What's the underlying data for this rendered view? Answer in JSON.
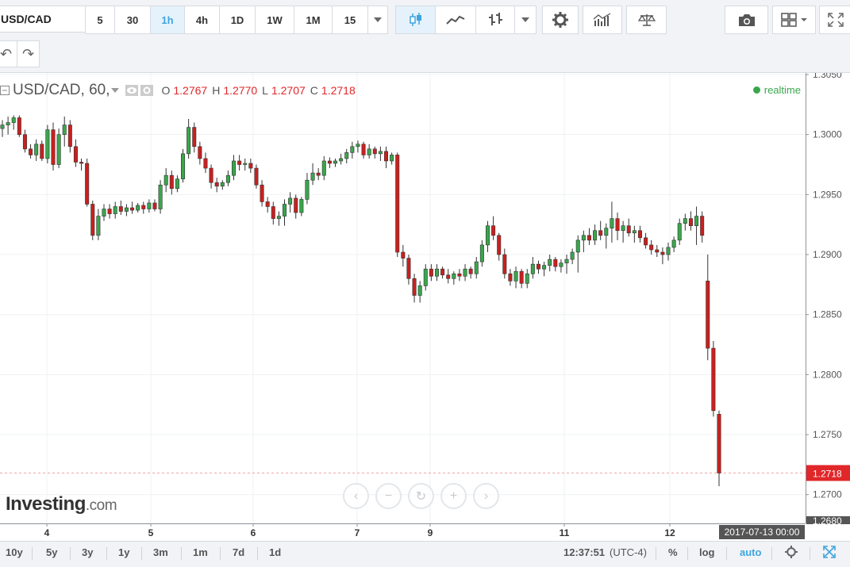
{
  "toolbar": {
    "symbol": "USD/CAD",
    "intervals": [
      "5",
      "30",
      "1h",
      "4h",
      "1D",
      "1W",
      "1M",
      "15"
    ],
    "active_interval": "1h"
  },
  "legend": {
    "symbol_label": "USD/CAD, 60,",
    "o_label": "O",
    "o_value": "1.2767",
    "h_label": "H",
    "h_value": "1.2770",
    "l_label": "L",
    "l_value": "1.2707",
    "c_label": "C",
    "c_value": "1.2718",
    "realtime": "realtime"
  },
  "logo": {
    "main": "Investing",
    "suffix": ".com"
  },
  "bottom": {
    "ranges": [
      "10y",
      "5y",
      "3y",
      "1y",
      "3m",
      "1m",
      "7d",
      "1d"
    ],
    "time": "12:37:51",
    "tz": "(UTC-4)",
    "percent": "%",
    "log": "log",
    "auto": "auto"
  },
  "colors": {
    "up": "#3aa64c",
    "down": "#c9201f",
    "accent": "#3da5e0",
    "price_tag": "#e0272a"
  },
  "chart_data": {
    "type": "candlestick",
    "symbol": "USD/CAD",
    "interval": "60",
    "x_ticks": [
      "4",
      "5",
      "6",
      "7",
      "9",
      "11",
      "12"
    ],
    "crosshair_label": "2017-07-13 00:00",
    "y_ticks": [
      "1.2680",
      "1.2700",
      "1.2718",
      "1.2750",
      "1.2800",
      "1.2850",
      "1.2900",
      "1.2950",
      "1.3000",
      "1.3050"
    ],
    "ylim": [
      1.268,
      1.305
    ],
    "last_price": 1.2718,
    "grid": true,
    "candles": [
      [
        1.3005,
        1.3012,
        1.2998,
        1.3008
      ],
      [
        1.3008,
        1.3015,
        1.3,
        1.301
      ],
      [
        1.301,
        1.3016,
        1.3004,
        1.3014
      ],
      [
        1.3014,
        1.3016,
        1.2998,
        1.3
      ],
      [
        1.3,
        1.3004,
        1.2985,
        1.2988
      ],
      [
        1.2988,
        1.2992,
        1.298,
        1.2983
      ],
      [
        1.2983,
        1.2996,
        1.2978,
        1.2992
      ],
      [
        1.2992,
        1.2995,
        1.2978,
        1.298
      ],
      [
        1.298,
        1.3008,
        1.2976,
        1.3004
      ],
      [
        1.3004,
        1.301,
        1.297,
        1.2975
      ],
      [
        1.2975,
        1.3005,
        1.2972,
        1.3
      ],
      [
        1.3,
        1.3015,
        1.299,
        1.3008
      ],
      [
        1.3008,
        1.3012,
        1.2985,
        1.299
      ],
      [
        1.299,
        1.2996,
        1.2973,
        1.2977
      ],
      [
        1.2977,
        1.298,
        1.297,
        1.2976
      ],
      [
        1.2976,
        1.298,
        1.294,
        1.2942
      ],
      [
        1.2942,
        1.2945,
        1.2912,
        1.2916
      ],
      [
        1.2916,
        1.2938,
        1.2912,
        1.2932
      ],
      [
        1.2932,
        1.2942,
        1.2928,
        1.2938
      ],
      [
        1.2938,
        1.2942,
        1.293,
        1.2934
      ],
      [
        1.2934,
        1.2944,
        1.293,
        1.294
      ],
      [
        1.294,
        1.2945,
        1.2933,
        1.2936
      ],
      [
        1.2936,
        1.2942,
        1.2932,
        1.2939
      ],
      [
        1.2939,
        1.2944,
        1.2934,
        1.2937
      ],
      [
        1.2937,
        1.2943,
        1.2935,
        1.2941
      ],
      [
        1.2941,
        1.2944,
        1.2934,
        1.2938
      ],
      [
        1.2938,
        1.2946,
        1.2935,
        1.2943
      ],
      [
        1.2943,
        1.2946,
        1.2936,
        1.2938
      ],
      [
        1.2938,
        1.2962,
        1.2934,
        1.2958
      ],
      [
        1.2958,
        1.2972,
        1.2952,
        1.2966
      ],
      [
        1.2966,
        1.297,
        1.295,
        1.2955
      ],
      [
        1.2955,
        1.2966,
        1.2952,
        1.2963
      ],
      [
        1.2963,
        1.2988,
        1.296,
        1.2984
      ],
      [
        1.2984,
        1.3013,
        1.298,
        1.3006
      ],
      [
        1.3006,
        1.301,
        1.2985,
        1.299
      ],
      [
        1.299,
        1.2994,
        1.2975,
        1.298
      ],
      [
        1.298,
        1.2985,
        1.2968,
        1.2972
      ],
      [
        1.2972,
        1.2975,
        1.2955,
        1.296
      ],
      [
        1.296,
        1.2964,
        1.2952,
        1.2957
      ],
      [
        1.2957,
        1.2962,
        1.2954,
        1.296
      ],
      [
        1.296,
        1.297,
        1.2957,
        1.2966
      ],
      [
        1.2966,
        1.2983,
        1.2962,
        1.2978
      ],
      [
        1.2978,
        1.2983,
        1.297,
        1.2975
      ],
      [
        1.2975,
        1.298,
        1.297,
        1.2976
      ],
      [
        1.2976,
        1.298,
        1.2968,
        1.2972
      ],
      [
        1.2972,
        1.2975,
        1.2955,
        1.2958
      ],
      [
        1.2958,
        1.2962,
        1.294,
        1.2944
      ],
      [
        1.2944,
        1.2948,
        1.2935,
        1.294
      ],
      [
        1.294,
        1.2944,
        1.2925,
        1.293
      ],
      [
        1.293,
        1.2936,
        1.2924,
        1.2932
      ],
      [
        1.2932,
        1.2946,
        1.2924,
        1.2942
      ],
      [
        1.2942,
        1.2952,
        1.2935,
        1.2947
      ],
      [
        1.2947,
        1.295,
        1.293,
        1.2935
      ],
      [
        1.2935,
        1.2948,
        1.2932,
        1.2946
      ],
      [
        1.2946,
        1.2968,
        1.2942,
        1.2962
      ],
      [
        1.2962,
        1.2976,
        1.2958,
        1.2968
      ],
      [
        1.2968,
        1.2972,
        1.2962,
        1.2966
      ],
      [
        1.2966,
        1.2982,
        1.2962,
        1.2978
      ],
      [
        1.2978,
        1.2981,
        1.2972,
        1.2976
      ],
      [
        1.2976,
        1.298,
        1.2973,
        1.2978
      ],
      [
        1.2978,
        1.2984,
        1.2975,
        1.298
      ],
      [
        1.298,
        1.2988,
        1.2976,
        1.2985
      ],
      [
        1.2985,
        1.2994,
        1.298,
        1.299
      ],
      [
        1.299,
        1.2995,
        1.2985,
        1.2992
      ],
      [
        1.2992,
        1.2994,
        1.298,
        1.2983
      ],
      [
        1.2983,
        1.2992,
        1.298,
        1.2988
      ],
      [
        1.2988,
        1.299,
        1.298,
        1.2984
      ],
      [
        1.2984,
        1.299,
        1.2978,
        1.2986
      ],
      [
        1.2986,
        1.299,
        1.2972,
        1.2978
      ],
      [
        1.2978,
        1.2985,
        1.2975,
        1.2983
      ],
      [
        1.2983,
        1.2985,
        1.2898,
        1.2902
      ],
      [
        1.2902,
        1.2908,
        1.289,
        1.2897
      ],
      [
        1.2897,
        1.29,
        1.2875,
        1.288
      ],
      [
        1.288,
        1.2884,
        1.286,
        1.2866
      ],
      [
        1.2866,
        1.2878,
        1.286,
        1.2874
      ],
      [
        1.2874,
        1.2892,
        1.287,
        1.2888
      ],
      [
        1.2888,
        1.2892,
        1.2878,
        1.2882
      ],
      [
        1.2882,
        1.2892,
        1.2878,
        1.2888
      ],
      [
        1.2888,
        1.289,
        1.288,
        1.2883
      ],
      [
        1.2883,
        1.2888,
        1.2876,
        1.288
      ],
      [
        1.288,
        1.2886,
        1.2875,
        1.2884
      ],
      [
        1.2884,
        1.2888,
        1.2878,
        1.2882
      ],
      [
        1.2882,
        1.2892,
        1.2878,
        1.2888
      ],
      [
        1.2888,
        1.289,
        1.288,
        1.2884
      ],
      [
        1.2884,
        1.2898,
        1.288,
        1.2894
      ],
      [
        1.2894,
        1.2912,
        1.289,
        1.2908
      ],
      [
        1.2908,
        1.2928,
        1.2902,
        1.2924
      ],
      [
        1.2924,
        1.2932,
        1.2912,
        1.2916
      ],
      [
        1.2916,
        1.2918,
        1.2895,
        1.29
      ],
      [
        1.29,
        1.2905,
        1.288,
        1.2884
      ],
      [
        1.2884,
        1.2888,
        1.2874,
        1.2878
      ],
      [
        1.2878,
        1.289,
        1.2872,
        1.2886
      ],
      [
        1.2886,
        1.2888,
        1.2872,
        1.2876
      ],
      [
        1.2876,
        1.2888,
        1.2872,
        1.2884
      ],
      [
        1.2884,
        1.2898,
        1.288,
        1.2892
      ],
      [
        1.2892,
        1.2895,
        1.2884,
        1.2888
      ],
      [
        1.2888,
        1.2894,
        1.2882,
        1.2891
      ],
      [
        1.2891,
        1.29,
        1.2886,
        1.2896
      ],
      [
        1.2896,
        1.2898,
        1.2886,
        1.289
      ],
      [
        1.289,
        1.2896,
        1.2885,
        1.2893
      ],
      [
        1.2893,
        1.29,
        1.2884,
        1.2896
      ],
      [
        1.2896,
        1.2905,
        1.2892,
        1.2902
      ],
      [
        1.2902,
        1.2916,
        1.2885,
        1.2912
      ],
      [
        1.2912,
        1.292,
        1.2902,
        1.2916
      ],
      [
        1.2916,
        1.2922,
        1.2908,
        1.2912
      ],
      [
        1.2912,
        1.2925,
        1.2908,
        1.292
      ],
      [
        1.292,
        1.2928,
        1.2912,
        1.2916
      ],
      [
        1.2916,
        1.2926,
        1.2905,
        1.2922
      ],
      [
        1.2922,
        1.2944,
        1.291,
        1.293
      ],
      [
        1.293,
        1.2935,
        1.2912,
        1.292
      ],
      [
        1.292,
        1.2928,
        1.291,
        1.2924
      ],
      [
        1.2924,
        1.293,
        1.2915,
        1.2918
      ],
      [
        1.2918,
        1.2924,
        1.291,
        1.292
      ],
      [
        1.292,
        1.2924,
        1.291,
        1.2914
      ],
      [
        1.2914,
        1.2918,
        1.2905,
        1.2908
      ],
      [
        1.2908,
        1.2912,
        1.29,
        1.2904
      ],
      [
        1.2904,
        1.2908,
        1.2898,
        1.2902
      ],
      [
        1.2902,
        1.2906,
        1.2892,
        1.29
      ],
      [
        1.29,
        1.291,
        1.2895,
        1.2906
      ],
      [
        1.2906,
        1.2915,
        1.2902,
        1.2912
      ],
      [
        1.2912,
        1.293,
        1.2908,
        1.2926
      ],
      [
        1.2926,
        1.2934,
        1.292,
        1.293
      ],
      [
        1.293,
        1.2936,
        1.292,
        1.2924
      ],
      [
        1.2924,
        1.294,
        1.2908,
        1.2932
      ],
      [
        1.2932,
        1.2936,
        1.291,
        1.2916
      ],
      [
        1.2878,
        1.29,
        1.2812,
        1.2822
      ],
      [
        1.2822,
        1.2828,
        1.2765,
        1.277
      ],
      [
        1.2767,
        1.277,
        1.2707,
        1.2718
      ]
    ]
  }
}
